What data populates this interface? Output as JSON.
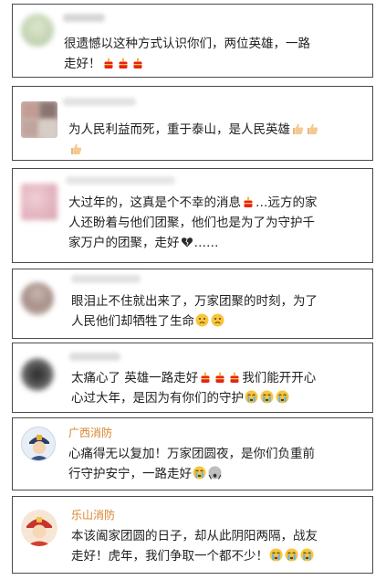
{
  "comments": [
    {
      "id": 1,
      "username": "",
      "lines": [
        "很遗憾以这种方式认识你们，两位英雄，一路",
        "走好！"
      ],
      "emojis": [
        "candle-icon",
        "candle-icon",
        "candle-icon"
      ]
    },
    {
      "id": 2,
      "username": "",
      "lines": [
        "为人民利益而死，重于泰山，是人民英雄"
      ],
      "emojis": [
        "thumbs-up-icon",
        "thumbs-up-icon",
        "thumbs-up-icon"
      ]
    },
    {
      "id": 3,
      "username": "",
      "lines": [
        "大过年的，这真是个不幸的消息",
        "…远方的家",
        "人还盼着与他们团聚，他们也是为了为守护千",
        "家万户的团聚，走好",
        "……"
      ]
    },
    {
      "id": 4,
      "username": "",
      "lines": [
        "眼泪止不住就出来了，万家团聚的时刻，为了",
        "人民他们却牺牲了生命"
      ]
    },
    {
      "id": 5,
      "username": "",
      "lines": [
        "太痛心了 英雄一路走好",
        "我们能开开心",
        "心过大年，是因为有你们的守护"
      ]
    },
    {
      "id": 6,
      "username": "广西消防",
      "lines": [
        "心痛得无以复加！万家团圆夜，是你们负重前",
        "行守护安宁，一路走好"
      ]
    },
    {
      "id": 7,
      "username": "乐山消防",
      "lines": [
        "本该阖家团圆的日子，却从此阴阳两隔，战友",
        "走好！虎年，我们争取一个都不少！"
      ]
    }
  ],
  "colors": {
    "username": "#d9822b",
    "border": "#4a4a4a",
    "text": "#1f1f1f"
  }
}
